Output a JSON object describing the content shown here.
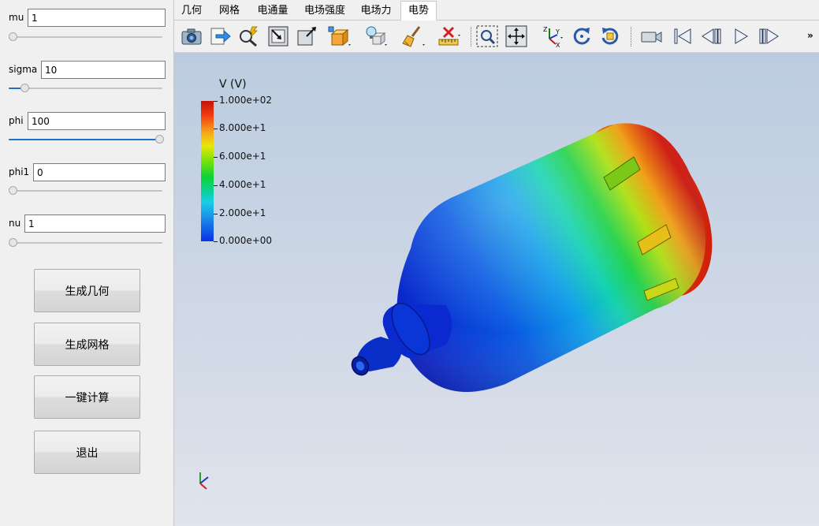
{
  "params": [
    {
      "label": "mu",
      "value": "1"
    },
    {
      "label": "sigma",
      "value": "10"
    },
    {
      "label": "phi",
      "value": "100"
    },
    {
      "label": "phi1",
      "value": "0"
    },
    {
      "label": "nu",
      "value": "1"
    }
  ],
  "buttons": {
    "generate_geometry": "生成几何",
    "generate_mesh": "生成网格",
    "compute": "一键计算",
    "exit": "退出"
  },
  "tabs": [
    "几何",
    "网格",
    "电通量",
    "电场强度",
    "电场力",
    "电势"
  ],
  "active_tab": "电势",
  "toolbar_icons": [
    "camera-icon",
    "export-icon",
    "zoom-auto-icon",
    "reset-camera-icon",
    "zoom-to-box-icon",
    "view-cube-icon",
    "light-icon",
    "box-icon",
    "clear-brush-icon",
    "ruler-icon",
    "zoom-region-icon",
    "move-icon",
    "axes-orientation-icon",
    "rotate-cw-icon",
    "rotate-ccw-icon",
    "video-camera-icon",
    "first-frame-icon",
    "prev-frame-icon",
    "play-icon",
    "next-frame-icon"
  ],
  "toolbar_more": "»",
  "legend": {
    "title": "V (V)",
    "labels": [
      "1.000e+02",
      "8.000e+1",
      "6.000e+1",
      "4.000e+1",
      "2.000e+1",
      "0.000e+00"
    ],
    "min": 0,
    "max": 100
  },
  "colors": {
    "accent": "#1e73c8",
    "colormap_high": "#d0100a",
    "colormap_low": "#0a28d4"
  }
}
